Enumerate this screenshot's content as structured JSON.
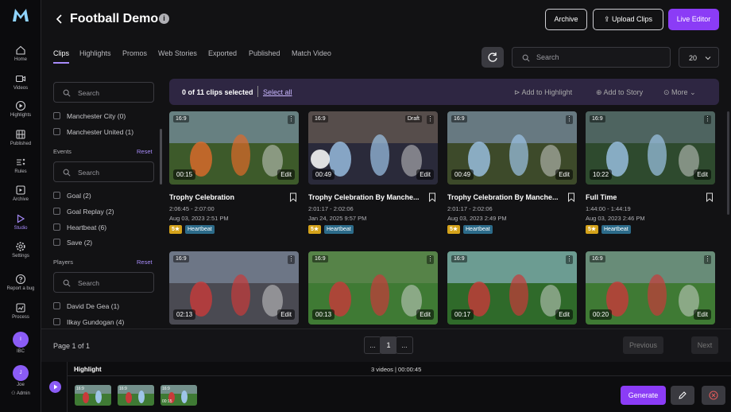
{
  "rail": {
    "items": [
      {
        "label": "Home",
        "icon": "home-icon"
      },
      {
        "label": "Videos",
        "icon": "video-icon"
      },
      {
        "label": "Highlights",
        "icon": "play-circle-icon"
      },
      {
        "label": "Published",
        "icon": "film-icon"
      },
      {
        "label": "Rules",
        "icon": "rules-icon"
      },
      {
        "label": "Archive",
        "icon": "archive-icon"
      },
      {
        "label": "Studio",
        "icon": "studio-icon"
      },
      {
        "label": "Settings",
        "icon": "gear-icon"
      },
      {
        "label": "Report a bug",
        "icon": "help-icon"
      },
      {
        "label": "Process",
        "icon": "process-icon"
      }
    ],
    "org": {
      "initial": "I",
      "label": "IBC"
    },
    "user": {
      "initial": "J",
      "name": "Joe",
      "role": "Admin"
    }
  },
  "header": {
    "title": "Football Demo",
    "archive_label": "Archive",
    "upload_label": "Upload Clips",
    "live_editor_label": "Live Editor"
  },
  "tabs": [
    "Clips",
    "Highlights",
    "Promos",
    "Web Stories",
    "Exported",
    "Published",
    "Match Video"
  ],
  "toolbar": {
    "search_placeholder": "Search",
    "page_size": "20"
  },
  "filters": {
    "search_placeholder": "Search",
    "teams": [
      "Manchester City (0)",
      "Manchester United (1)"
    ],
    "events_label": "Events",
    "reset_label": "Reset",
    "events": [
      "Goal (2)",
      "Goal Replay (2)",
      "Heartbeat (6)",
      "Save (2)"
    ],
    "players_label": "Players",
    "players": [
      "David De Gea (1)",
      "Ilkay Gundogan (4)"
    ]
  },
  "selection": {
    "count_text": "0 of 11 clips selected",
    "select_all": "Select all",
    "add_highlight": "Add to Highlight",
    "add_story": "Add to Story",
    "more": "More"
  },
  "clips": [
    {
      "ratio": "16:9",
      "draft": "",
      "duration": "00:15",
      "edit": "Edit",
      "title": "Trophy Celebration",
      "time": "2:06:45 - 2:07:00",
      "date": "Aug 03, 2023 2:51 PM",
      "rating": "5★",
      "tag": "Heartbeat"
    },
    {
      "ratio": "16:9",
      "draft": "Draft",
      "duration": "00:49",
      "edit": "Edit",
      "title": "Trophy Celebration By Manche...",
      "time": "2:01:17 - 2:02:06",
      "date": "Jan 24, 2025 9:57 PM",
      "rating": "5★",
      "tag": "Heartbeat"
    },
    {
      "ratio": "16:9",
      "draft": "",
      "duration": "00:49",
      "edit": "Edit",
      "title": "Trophy Celebration By Manche...",
      "time": "2:01:17 - 2:02:06",
      "date": "Aug 03, 2023 2:49 PM",
      "rating": "5★",
      "tag": "Heartbeat"
    },
    {
      "ratio": "16:9",
      "draft": "",
      "duration": "10:22",
      "edit": "Edit",
      "title": "Full Time",
      "time": "1:44:00 - 1:44:19",
      "date": "Aug 03, 2023 2:46 PM",
      "rating": "5★",
      "tag": "Heartbeat"
    },
    {
      "ratio": "16:9",
      "draft": "",
      "duration": "02:13",
      "edit": "Edit"
    },
    {
      "ratio": "16:9",
      "draft": "",
      "duration": "00:13",
      "edit": "Edit"
    },
    {
      "ratio": "16:9",
      "draft": "",
      "duration": "00:17",
      "edit": "Edit"
    },
    {
      "ratio": "16:9",
      "draft": "",
      "duration": "00:20",
      "edit": "Edit"
    }
  ],
  "pager": {
    "page_of": "Page 1 of 1",
    "ellipsis": "...",
    "current": "1",
    "previous": "Previous",
    "next": "Next"
  },
  "tray": {
    "label": "Highlight",
    "count": "3 videos | 00:00:45",
    "minis": [
      {
        "ratio": "16:9",
        "dur": ""
      },
      {
        "ratio": "16:9",
        "dur": ""
      },
      {
        "ratio": "16:9",
        "dur": "00:15"
      }
    ],
    "generate_label": "Generate"
  },
  "colors": {
    "accent": "#8b3cf6",
    "rating": "#d4a21a",
    "tag": "#2c6b8a"
  }
}
